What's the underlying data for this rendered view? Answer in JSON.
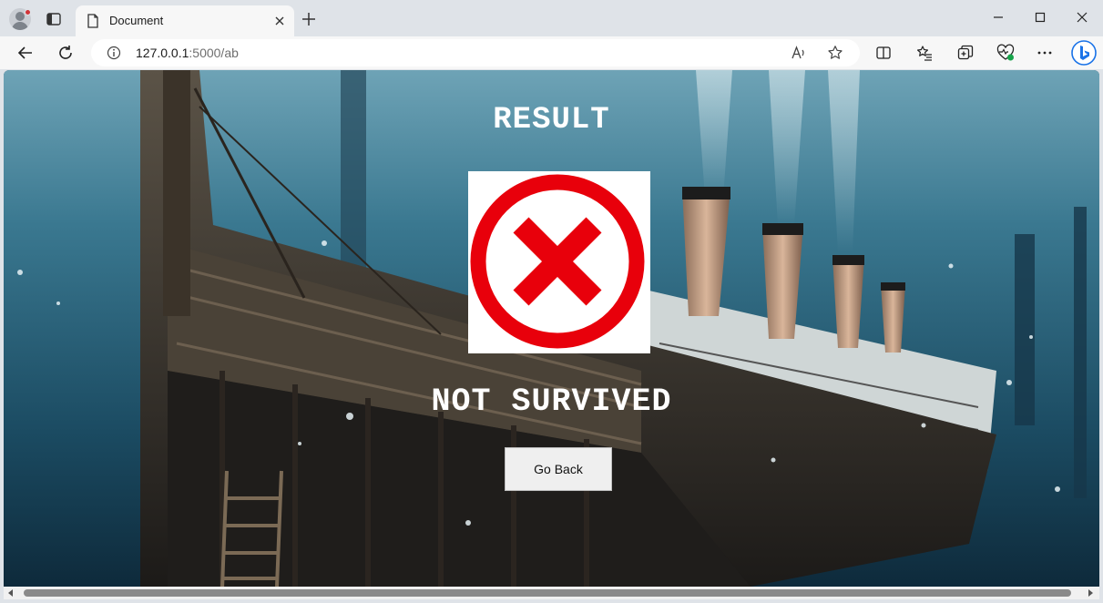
{
  "browser": {
    "tab_title": "Document",
    "url_host": "127.0.0.1",
    "url_path": ":5000/ab"
  },
  "page": {
    "heading": "RESULT",
    "status": "NOT SURVIVED",
    "back_button": "Go Back",
    "status_icon": "red-cross-circle-icon"
  },
  "colors": {
    "cross_red": "#e8000b",
    "tab_bg": "#f7f7f7",
    "chrome_bg": "#dfe3e8"
  }
}
